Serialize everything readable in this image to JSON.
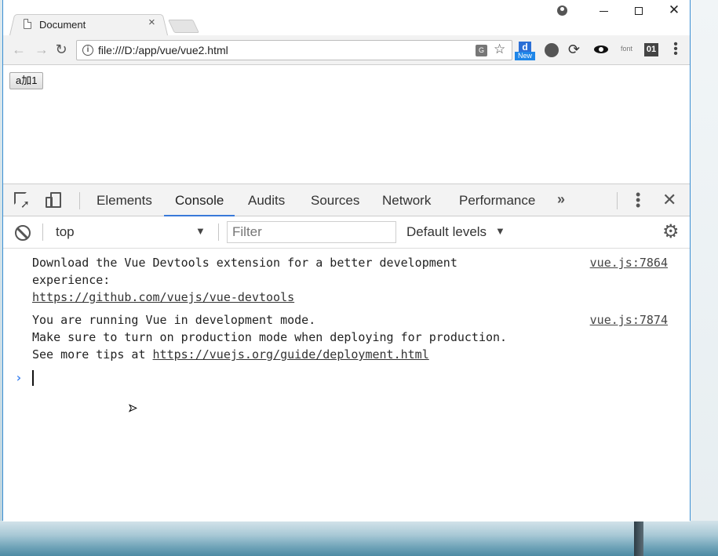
{
  "browser": {
    "tab_title": "Document",
    "tab_close": "×",
    "url": "file:///D:/app/vue/vue2.html",
    "nav": {
      "back": "←",
      "forward": "→",
      "reload": "↻"
    },
    "extensions": {
      "d_badge": "d",
      "d_new": "New",
      "font_label": "font",
      "counter_label": "01"
    },
    "translate_glyph": "G",
    "star_glyph": "☆",
    "menu_glyph": "⋮"
  },
  "page": {
    "button_label": "a加1"
  },
  "devtools": {
    "tabs": [
      "Elements",
      "Console",
      "Audits",
      "Sources",
      "Network",
      "Performance"
    ],
    "active_tab": "Console",
    "more_glyph": "»",
    "kebab_glyph": "⋮",
    "close_glyph": "✕",
    "context": "top",
    "filter_placeholder": "Filter",
    "levels": "Default levels",
    "dropdown_glyph": "▼",
    "gear_glyph": "⚙"
  },
  "console": {
    "messages": [
      {
        "lines": [
          "Download the Vue Devtools extension for a better development",
          "experience:"
        ],
        "link": "https://github.com/vuejs/vue-devtools",
        "source": "vue.js:7864"
      },
      {
        "lines": [
          "You are running Vue in development mode.",
          "Make sure to turn on production mode when deploying for production."
        ],
        "prefix": "See more tips at ",
        "link": "https://vuejs.org/guide/deployment.html",
        "source": "vue.js:7874"
      }
    ],
    "prompt": "›"
  }
}
